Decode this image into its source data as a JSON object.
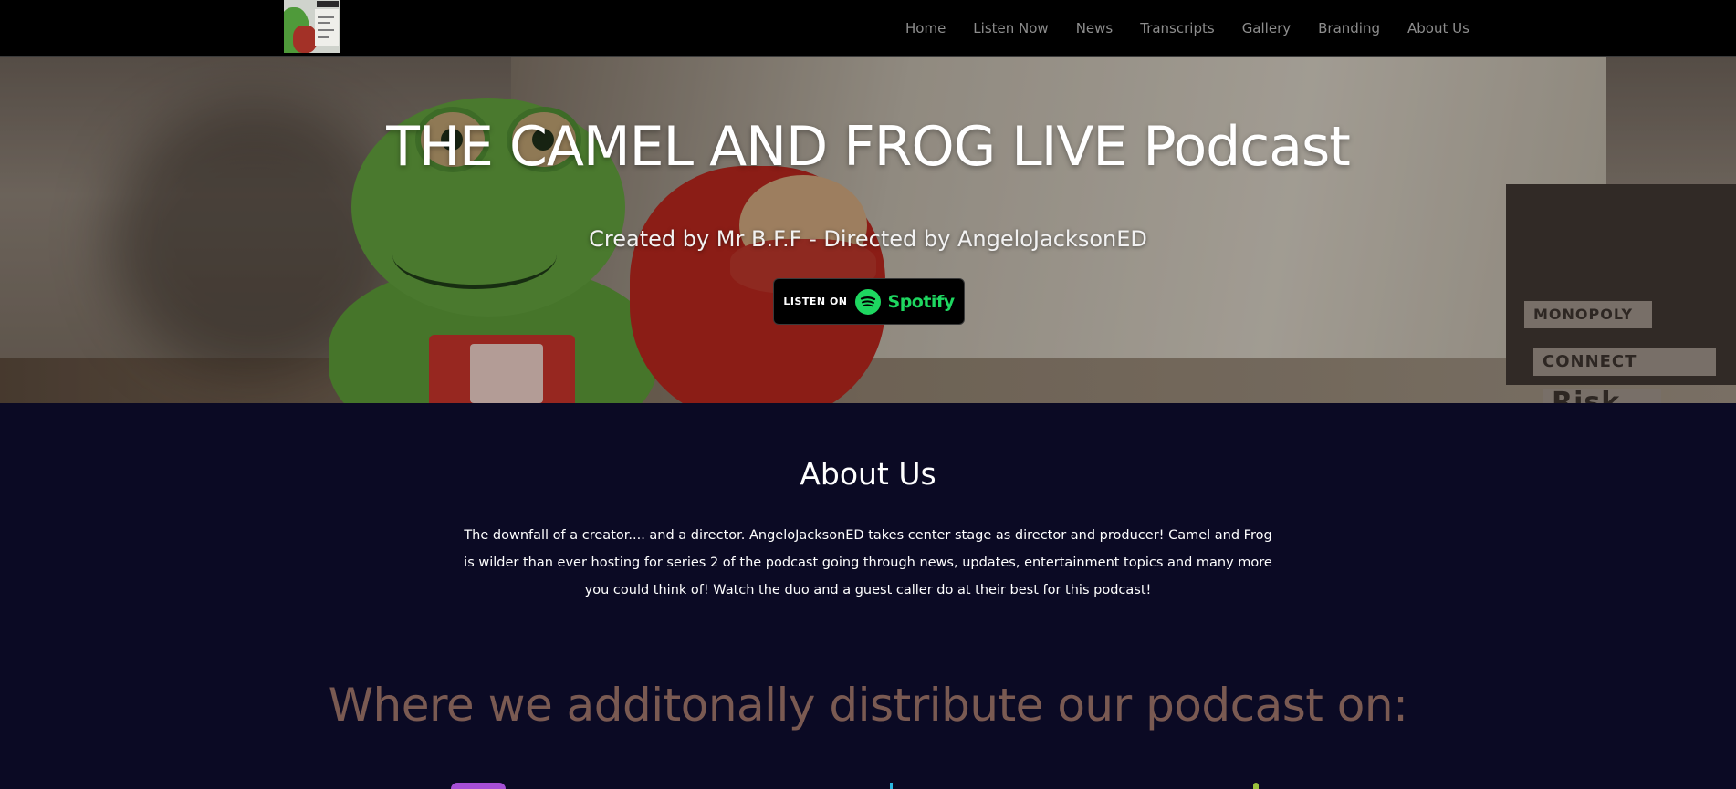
{
  "header": {
    "logo_alt": "Camel and Frog Live logo",
    "nav": [
      "Home",
      "Listen Now",
      "News",
      "Transcripts",
      "Gallery",
      "Branding",
      "About Us"
    ]
  },
  "hero": {
    "title": "THE CAMEL AND FROG LIVE Podcast",
    "subtitle": "Created by Mr B.F.F - Directed by AngeloJacksonED",
    "cta": {
      "prefix": "LISTEN ON",
      "brand": "Spotify",
      "icon": "spotify-icon"
    },
    "background_box_labels": [
      "MONOPOLY",
      "CONNECT",
      "Risk"
    ]
  },
  "about": {
    "title": "About Us",
    "text": "The downfall of a creator.... and a director. AngeloJacksonED takes center stage as director and producer! Camel and Frog is wilder than ever hosting for series 2 of the podcast going through news, updates, entertainment topics and many more you could think of! Watch the duo and a guest caller do at their best for this podcast!"
  },
  "distribution": {
    "title": "Where we additonally distribute our podcast on:",
    "platform_icons": [
      "apple-podcasts-icon",
      "google-podcasts-icon",
      "podcast-platform-icon"
    ]
  },
  "colors": {
    "nav_bg": "#000000",
    "nav_link": "#8d8d8d",
    "page_bg": "#0b0a24",
    "distribute_title": "#7a5a52",
    "spotify_green": "#1ed760"
  }
}
